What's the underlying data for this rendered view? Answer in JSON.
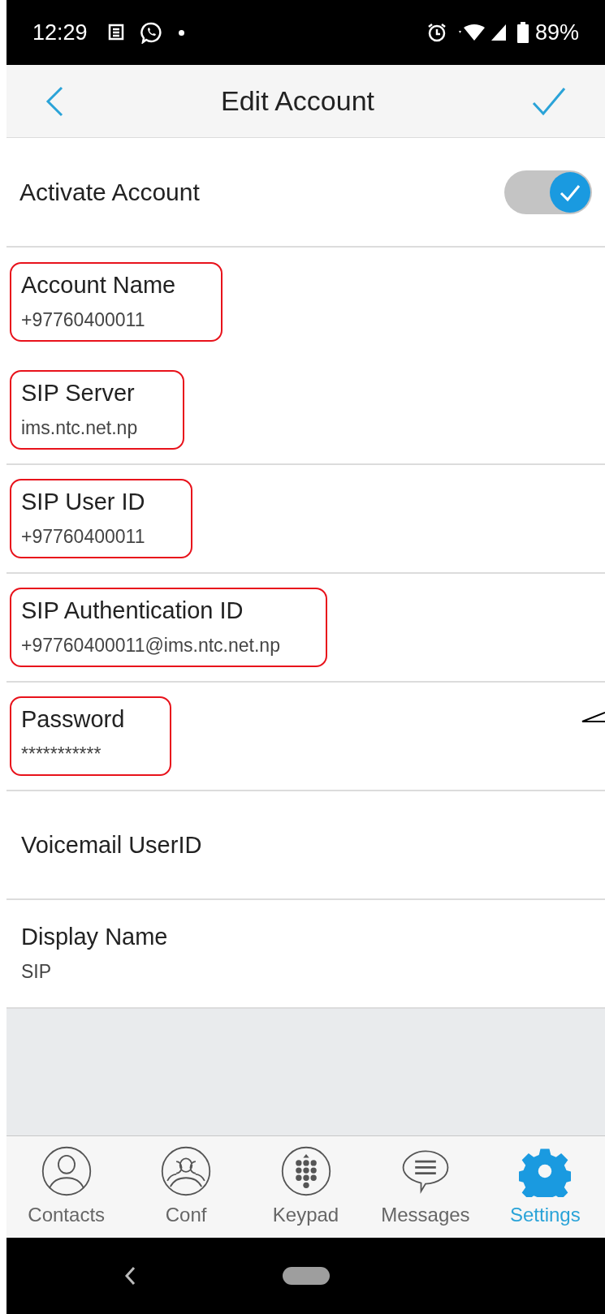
{
  "status_bar": {
    "time": "12:29",
    "battery": "89%"
  },
  "header": {
    "title": "Edit Account"
  },
  "rows": [
    {
      "kind": "toggle",
      "label": "Activate Account",
      "on": true
    },
    {
      "kind": "field",
      "label": "Account Name",
      "value": "+97760400011",
      "highlighted": true
    },
    {
      "kind": "field",
      "label": "SIP Server",
      "value": "ims.ntc.net.np",
      "highlighted": true
    },
    {
      "kind": "field",
      "label": "SIP User ID",
      "value": "+97760400011",
      "highlighted": true
    },
    {
      "kind": "field",
      "label": "SIP Authentication ID",
      "value": "+97760400011@ims.ntc.net.np",
      "highlighted": true
    },
    {
      "kind": "field",
      "label": "Password",
      "value": "***********",
      "highlighted": true
    },
    {
      "kind": "field",
      "label": "Voicemail UserID",
      "highlighted": false
    },
    {
      "kind": "field",
      "label": "Display Name",
      "value": "SIP",
      "highlighted": false
    }
  ],
  "tabs": [
    {
      "kind": "contacts",
      "label": "Contacts",
      "selected": false
    },
    {
      "kind": "conf",
      "label": "Conf",
      "selected": false
    },
    {
      "kind": "keypad",
      "label": "Keypad",
      "selected": false
    },
    {
      "kind": "messages",
      "label": "Messages",
      "selected": false
    },
    {
      "kind": "settings",
      "label": "Settings",
      "selected": true
    }
  ]
}
